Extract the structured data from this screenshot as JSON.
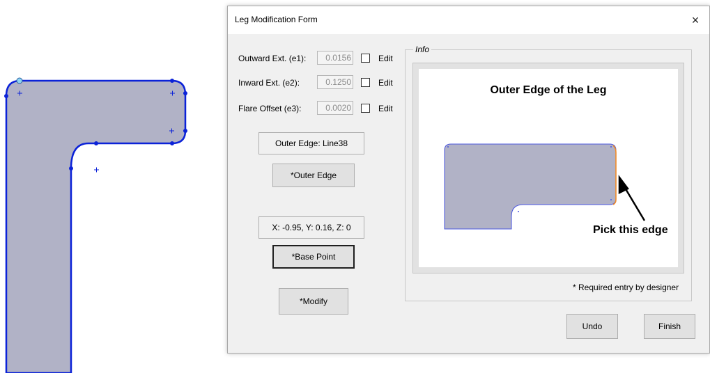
{
  "dialog": {
    "title": "Leg Modification Form",
    "close_glyph": "×",
    "fields": [
      {
        "label": "Outward Ext. (e1):",
        "value": "0.0156",
        "edit_label": "Edit",
        "edit_checked": false
      },
      {
        "label": "Inward Ext. (e2):",
        "value": "0.1250",
        "edit_label": "Edit",
        "edit_checked": false
      },
      {
        "label": "Flare Offset (e3):",
        "value": "0.0020",
        "edit_label": "Edit",
        "edit_checked": false
      }
    ],
    "outer_edge_readout": "Outer Edge: Line38",
    "outer_edge_button": "*Outer Edge",
    "base_point_readout": "X: -0.95, Y: 0.16, Z: 0",
    "base_point_button": "*Base Point",
    "modify_button": "*Modify",
    "undo_button": "Undo",
    "finish_button": "Finish"
  },
  "info": {
    "legend": "Info",
    "image_title": "Outer Edge of the Leg",
    "pick_label": "Pick this edge",
    "required_note": "* Required entry by designer"
  },
  "colors": {
    "cad_fill": "#b1b2c6",
    "cad_outline": "#0b22d8",
    "highlight_edge": "#f28c28",
    "dialog_bg": "#f0f0f0"
  },
  "icons": [
    "close-icon",
    "checkbox-icon",
    "arrow-icon"
  ]
}
